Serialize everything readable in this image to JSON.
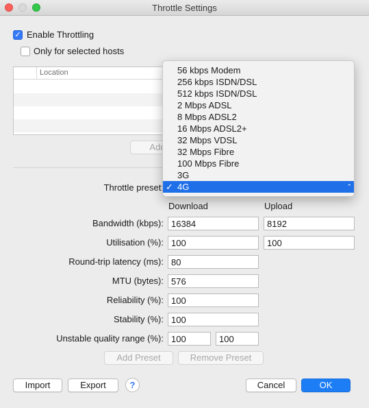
{
  "window": {
    "title": "Throttle Settings"
  },
  "enable_throttling": {
    "label": "Enable Throttling",
    "checked": true
  },
  "only_selected_hosts": {
    "label": "Only for selected hosts",
    "checked": false
  },
  "hosts_table": {
    "columns": [
      "",
      "Location"
    ]
  },
  "hosts_add_button": "Add",
  "preset": {
    "label": "Throttle preset:",
    "options": [
      "56 kbps Modem",
      "256 kbps ISDN/DSL",
      "512 kbps ISDN/DSL",
      "2 Mbps ADSL",
      "8 Mbps ADSL2",
      "16 Mbps ADSL2+",
      "32 Mbps VDSL",
      "32 Mbps Fibre",
      "100 Mbps Fibre",
      "3G",
      "4G"
    ],
    "selected": "4G",
    "check_glyph": "✓"
  },
  "columns": {
    "download": "Download",
    "upload": "Upload"
  },
  "fields": {
    "bandwidth": {
      "label": "Bandwidth (kbps):",
      "download": "16384",
      "upload": "8192"
    },
    "utilisation": {
      "label": "Utilisation (%):",
      "download": "100",
      "upload": "100"
    },
    "latency": {
      "label": "Round-trip latency (ms):",
      "value": "80"
    },
    "mtu": {
      "label": "MTU (bytes):",
      "value": "576"
    },
    "reliability": {
      "label": "Reliability (%):",
      "value": "100"
    },
    "stability": {
      "label": "Stability (%):",
      "value": "100"
    },
    "unstable_range": {
      "label": "Unstable quality range (%):",
      "min": "100",
      "max": "100"
    }
  },
  "buttons": {
    "add_preset": "Add Preset",
    "remove_preset": "Remove Preset",
    "import": "Import",
    "export": "Export",
    "help": "?",
    "cancel": "Cancel",
    "ok": "OK"
  },
  "colors": {
    "accent": "#1e6fe8",
    "ok_button": "#1c7df5",
    "window_bg": "#ececec"
  }
}
